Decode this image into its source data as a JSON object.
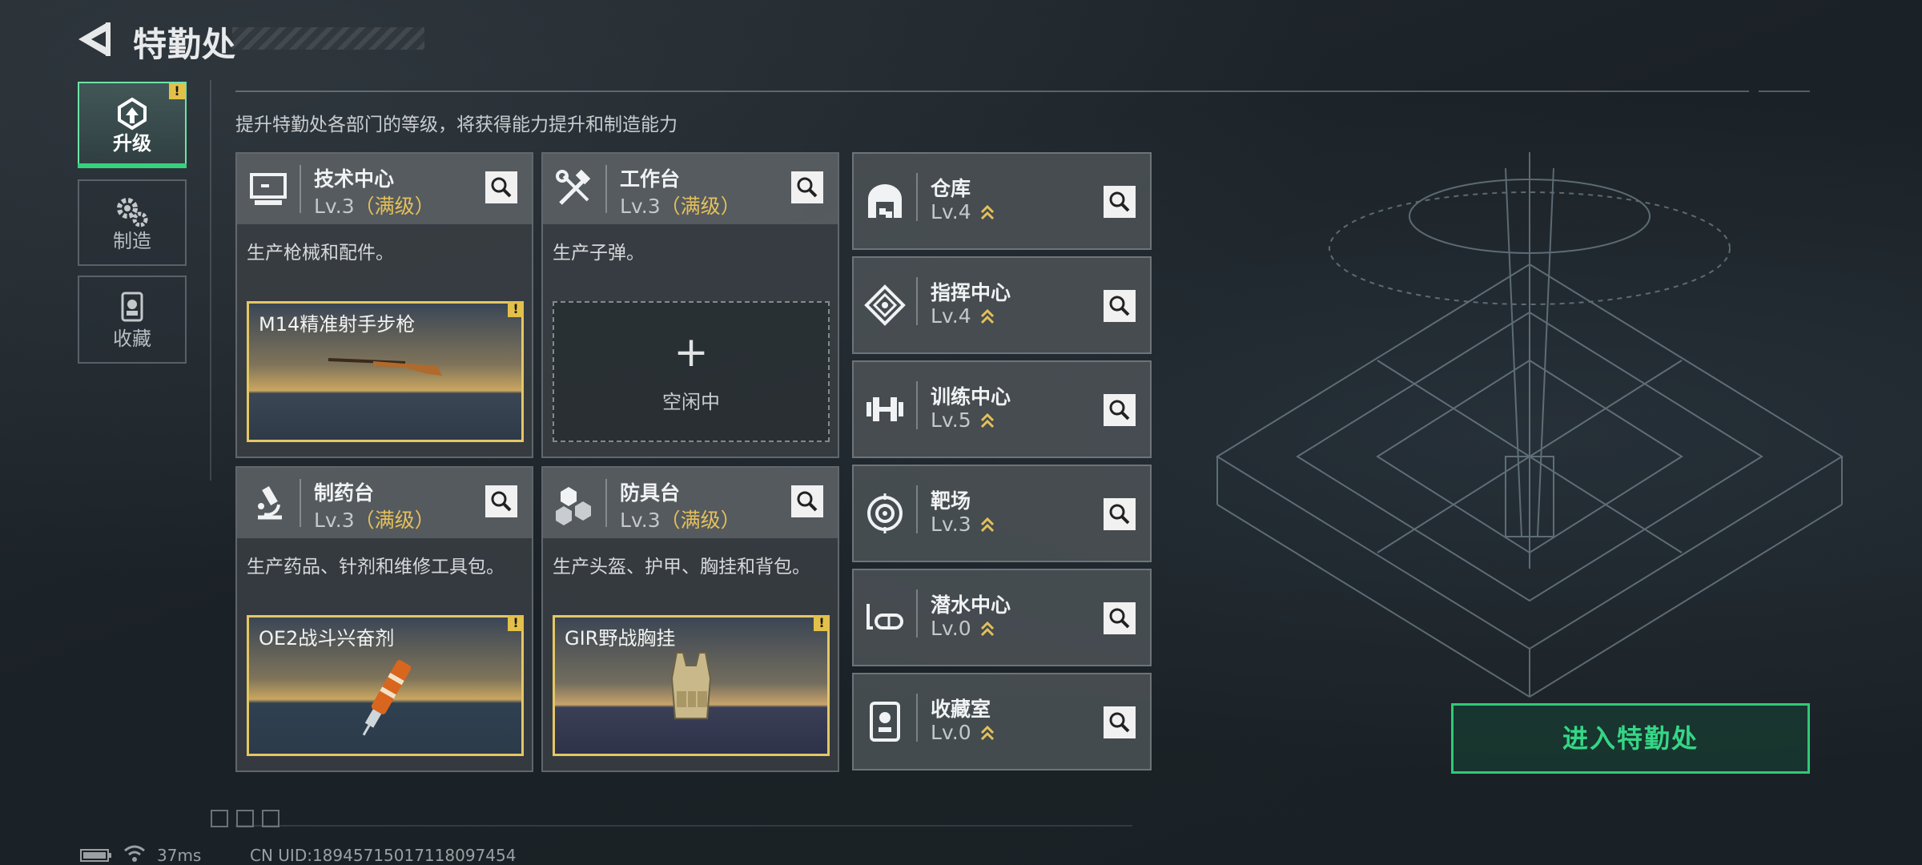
{
  "header": {
    "title": "特勤处"
  },
  "tabs": [
    {
      "label": "升级",
      "icon": "upgrade-icon",
      "active": true,
      "alert": "!"
    },
    {
      "label": "制造",
      "icon": "gears-icon",
      "active": false
    },
    {
      "label": "收藏",
      "icon": "collection-icon",
      "active": false
    }
  ],
  "subtitle": "提升特勤处各部门的等级，将获得能力提升和制造能力",
  "facilities": [
    {
      "name": "技术中心",
      "level": "Lv.3",
      "status": "（满级）",
      "description": "生产枪械和配件。",
      "crafting": {
        "item": "M14精准射手步枪",
        "alert": "!"
      }
    },
    {
      "name": "工作台",
      "level": "Lv.3",
      "status": "（满级）",
      "description": "生产子弹。",
      "idle": {
        "plus": "+",
        "label": "空闲中"
      }
    },
    {
      "name": "制药台",
      "level": "Lv.3",
      "status": "（满级）",
      "description": "生产药品、针剂和维修工具包。",
      "crafting": {
        "item": "OE2战斗兴奋剂",
        "alert": "!"
      }
    },
    {
      "name": "防具台",
      "level": "Lv.3",
      "status": "（满级）",
      "description": "生产头盔、护甲、胸挂和背包。",
      "crafting": {
        "item": "GIR野战胸挂",
        "alert": "!"
      }
    }
  ],
  "small_facilities": [
    {
      "name": "仓库",
      "level": "Lv.4"
    },
    {
      "name": "指挥中心",
      "level": "Lv.4"
    },
    {
      "name": "训练中心",
      "level": "Lv.5"
    },
    {
      "name": "靶场",
      "level": "Lv.3"
    },
    {
      "name": "潜水中心",
      "level": "Lv.0"
    },
    {
      "name": "收藏室",
      "level": "Lv.0"
    }
  ],
  "enter_button": "进入特勤处",
  "footer": {
    "ping": "37ms",
    "uid": "CN UID:18945715017118097454"
  },
  "colors": {
    "accent": "#37d17e",
    "max_level": "#e5c05a",
    "alert": "#e3c04a"
  }
}
